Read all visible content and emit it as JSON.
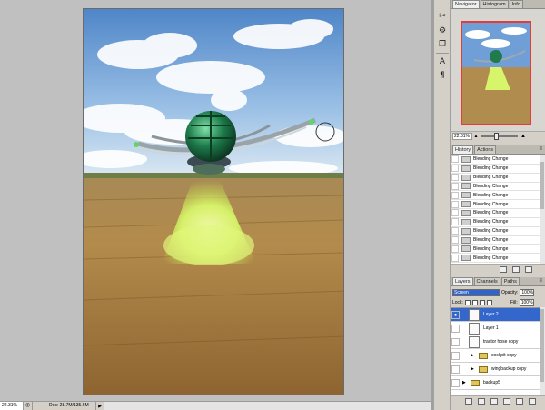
{
  "status_bar": {
    "zoom": "22.31%",
    "doc_size": "Doc: 28.7M/135.6M"
  },
  "navigator": {
    "tabs": [
      "Navigator",
      "Histogram",
      "Info"
    ],
    "zoom_value": "22.31%"
  },
  "history": {
    "tabs": [
      "History",
      "Actions"
    ],
    "items": [
      "Blending Change",
      "Blending Change",
      "Blending Change",
      "Blending Change",
      "Blending Change",
      "Blending Change",
      "Blending Change",
      "Blending Change",
      "Blending Change",
      "Blending Change",
      "Blending Change",
      "Blending Change"
    ]
  },
  "layers": {
    "tabs": [
      "Layers",
      "Channels",
      "Paths"
    ],
    "blend_mode": "Screen",
    "opacity_label": "Opacity:",
    "opacity_value": "100%",
    "lock_label": "Lock:",
    "fill_label": "Fill:",
    "fill_value": "100%",
    "items": [
      {
        "name": "Layer 2",
        "selected": true,
        "visible": true,
        "type": "layer"
      },
      {
        "name": "Layer 1",
        "selected": false,
        "visible": false,
        "type": "layer"
      },
      {
        "name": "tractor hose copy",
        "selected": false,
        "visible": false,
        "type": "layer"
      },
      {
        "name": "cockpit copy",
        "selected": false,
        "visible": false,
        "type": "group"
      },
      {
        "name": "wingbackup copy",
        "selected": false,
        "visible": false,
        "type": "group"
      },
      {
        "name": "backup5",
        "selected": false,
        "visible": false,
        "type": "group"
      }
    ]
  },
  "colors": {
    "selection": "#3367cc",
    "panel_bg": "#d4d0c8",
    "navigator_frame": "#e63b3b"
  }
}
